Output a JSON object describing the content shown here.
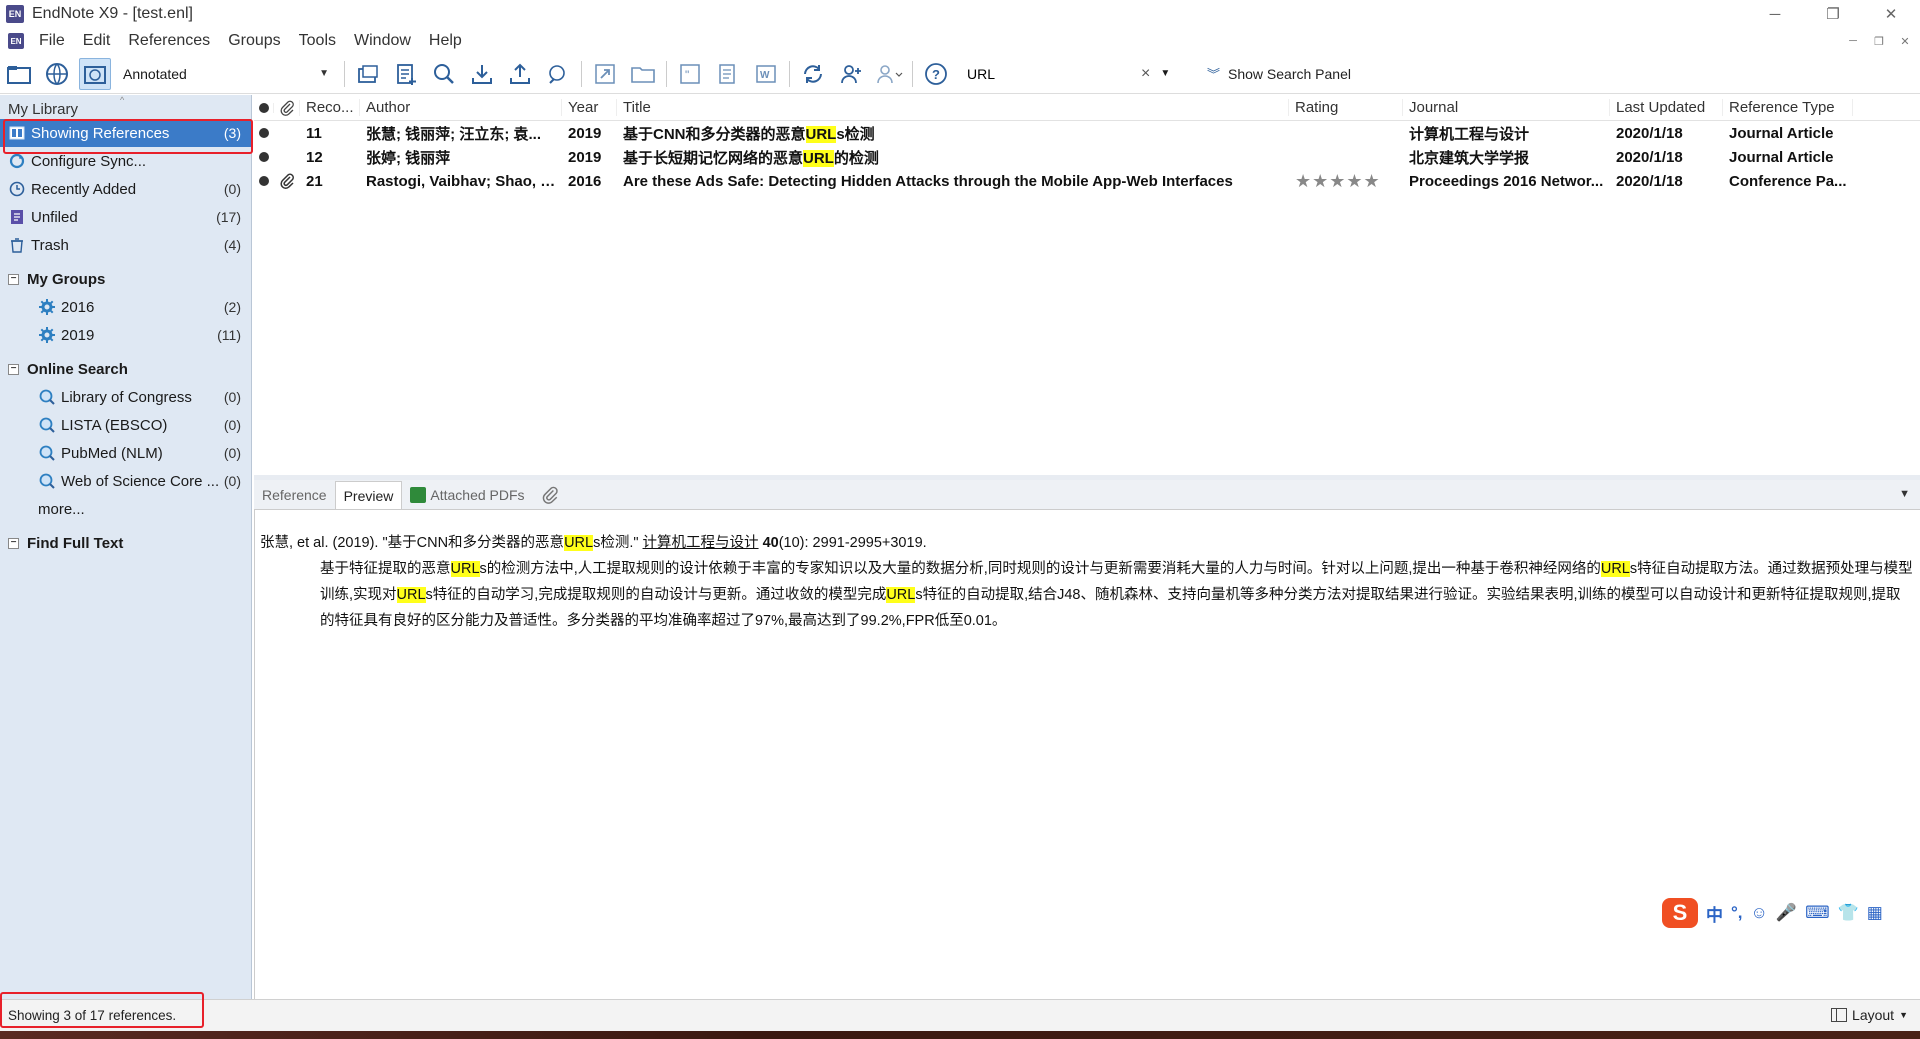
{
  "window": {
    "title": "EndNote X9 - [test.enl]",
    "app_icon_text": "EN",
    "minimize": "─",
    "restore": "❐",
    "close": "✕"
  },
  "menu": {
    "items": [
      "File",
      "Edit",
      "References",
      "Groups",
      "Tools",
      "Window",
      "Help"
    ]
  },
  "toolbar": {
    "style_value": "Annotated",
    "search_value": "URL",
    "clear_label": "×",
    "show_search_panel": "Show Search Panel"
  },
  "library": {
    "header": "My Library",
    "items": [
      {
        "label": "Showing References",
        "count": "(3)"
      },
      {
        "label": "Configure Sync...",
        "count": ""
      },
      {
        "label": "Recently Added",
        "count": "(0)"
      },
      {
        "label": "Unfiled",
        "count": "(17)"
      },
      {
        "label": "Trash",
        "count": "(4)"
      }
    ],
    "my_groups_title": "My Groups",
    "my_groups": [
      {
        "label": "2016",
        "count": "(2)"
      },
      {
        "label": "2019",
        "count": "(11)"
      }
    ],
    "online_search_title": "Online Search",
    "online_search": [
      {
        "label": "Library of Congress",
        "count": "(0)"
      },
      {
        "label": "LISTA (EBSCO)",
        "count": "(0)"
      },
      {
        "label": "PubMed (NLM)",
        "count": "(0)"
      },
      {
        "label": "Web of Science Core ...",
        "count": "(0)"
      }
    ],
    "more": "more...",
    "find_full_text": "Find Full Text"
  },
  "references": {
    "columns": {
      "record": "Reco...",
      "author": "Author",
      "year": "Year",
      "title": "Title",
      "rating": "Rating",
      "journal": "Journal",
      "updated": "Last Updated",
      "type": "Reference Type"
    },
    "rows": [
      {
        "record": "11",
        "author": "张慧; 钱丽萍; 汪立东; 袁...",
        "year": "2019",
        "title_pre": "基于CNN和多分类器的恶意",
        "title_hl": "URL",
        "title_post": "s检测",
        "rating": "",
        "journal": "计算机工程与设计",
        "updated": "2020/1/18",
        "type": "Journal Article",
        "attachment": false
      },
      {
        "record": "12",
        "author": "张婷; 钱丽萍",
        "year": "2019",
        "title_pre": "基于长短期记忆网络的恶意",
        "title_hl": "URL",
        "title_post": "的检测",
        "rating": "",
        "journal": "北京建筑大学学报",
        "updated": "2020/1/18",
        "type": "Journal Article",
        "attachment": false
      },
      {
        "record": "21",
        "author": "Rastogi, Vaibhav; Shao, R...",
        "year": "2016",
        "title_pre": "Are these Ads Safe: Detecting Hidden Attacks through the Mobile App-Web Interfaces",
        "title_hl": "",
        "title_post": "",
        "rating": "★★★★★",
        "journal": "Proceedings 2016 Networ...",
        "updated": "2020/1/18",
        "type": "Conference Pa...",
        "attachment": true
      }
    ]
  },
  "preview_tabs": {
    "reference": "Reference",
    "preview": "Preview",
    "attached_pdfs": "Attached PDFs"
  },
  "preview": {
    "cite_a": "张慧, et al. (2019). \"基于CNN和多分类器的恶意",
    "cite_hl": "URL",
    "cite_b": "s检测.\" ",
    "cite_journal": "计算机工程与设计",
    "cite_vol": "40",
    "cite_rest": "(10): 2991-2995+3019.",
    "abs_1": "基于特征提取的恶意",
    "abs_hl1": "URL",
    "abs_2": "s的检测方法中,人工提取规则的设计依赖于丰富的专家知识以及大量的数据分析,同时规则的设计与更新需要消耗大量的人力与时间。针对以上问题,提出一种基于卷积神经网络的",
    "abs_hl2": "URL",
    "abs_3": "s特征自动提取方法。通过数据预处理与模型训练,实现对",
    "abs_hl3": "URL",
    "abs_4": "s特征的自动学习,完成提取规则的自动设计与更新。通过收敛的模型完成",
    "abs_hl4": "URL",
    "abs_5": "s特征的自动提取,结合J48、随机森林、支持向量机等多种分类方法对提取结果进行验证。实验结果表明,训练的模型可以自动设计和更新特征提取规则,提取的特征具有良好的区分能力及普适性。多分类器的平均准确率超过了97%,最高达到了99.2%,FPR低至0.01。"
  },
  "ime": {
    "logo": "S",
    "items": [
      "中",
      "°,",
      "☺",
      "🎤",
      "⌨",
      "👕",
      "▦"
    ]
  },
  "status": {
    "text": "Showing 3 of 17 references.",
    "layout": "Layout"
  },
  "colors": {
    "selection": "#3b7bc8",
    "highlight": "#ffff1a",
    "annotation_box": "#e8202a",
    "left_panel_bg": "#dfe8f3"
  }
}
